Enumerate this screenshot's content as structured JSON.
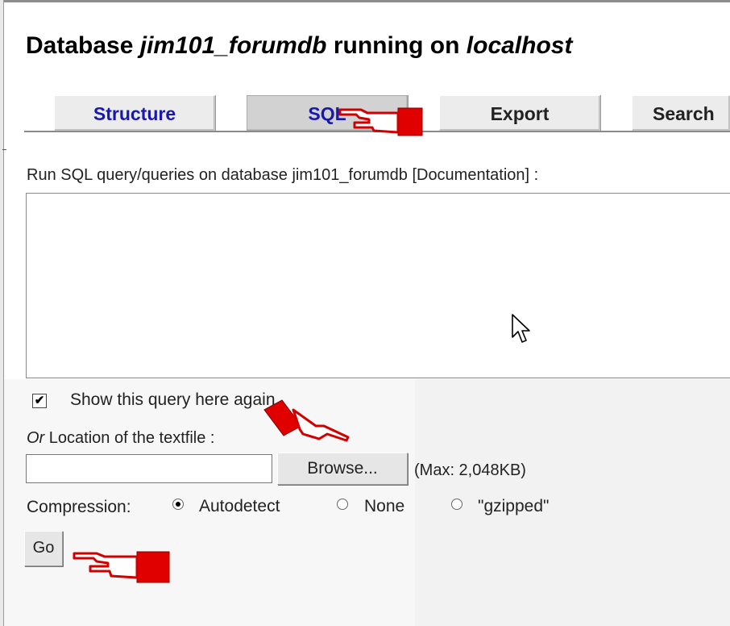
{
  "page": {
    "title_prefix": "Database ",
    "database_name": "jim101_forumdb",
    "title_middle": " running on ",
    "host": "localhost"
  },
  "tabs": [
    {
      "label": "Structure",
      "state": "link"
    },
    {
      "label": "SQL",
      "state": "active"
    },
    {
      "label": "Export",
      "state": "plain"
    },
    {
      "label": "Search",
      "state": "plain"
    }
  ],
  "sql_section": {
    "label": "Run SQL query/queries on database jim101_forumdb [Documentation] :",
    "query_value": ""
  },
  "options": {
    "show_query_label": "Show this query here again",
    "show_query_checked": true,
    "location_prefix": "Or",
    "location_label": " Location of the textfile :",
    "file_value": "",
    "browse_label": "Browse...",
    "max_size": "(Max: 2,048KB)",
    "compression_label": "Compression:",
    "compression_options": [
      {
        "label": "Autodetect",
        "selected": true
      },
      {
        "label": "None",
        "selected": false
      },
      {
        "label": "\"gzipped\"",
        "selected": false
      }
    ],
    "go_label": "Go"
  },
  "colors": {
    "link_blue": "#1818b0",
    "pointer_red": "#e00000"
  },
  "icons": [
    "pointing-hand-icon",
    "mouse-cursor-icon"
  ]
}
